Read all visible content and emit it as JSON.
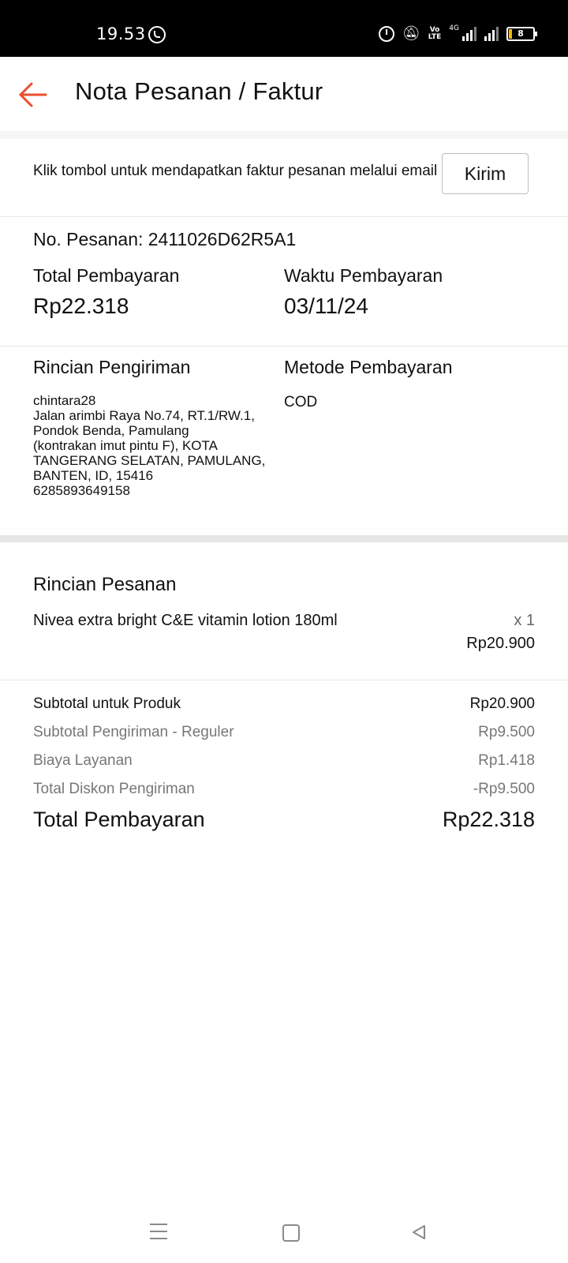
{
  "status_bar": {
    "time": "19.53",
    "network_labels": [
      "VoLTE",
      "4G"
    ],
    "battery": "8"
  },
  "header": {
    "title": "Nota Pesanan / Faktur",
    "accent_color": "#ee4d2d"
  },
  "email_invoice": {
    "message": "Klik tombol untuk mendapatkan faktur pesanan melalui email",
    "button_label": "Kirim"
  },
  "order": {
    "number_label": "No. Pesanan: 2411026D62R5A1",
    "total_label": "Total Pembayaran",
    "total_value": "Rp22.318",
    "payment_time_label": "Waktu Pembayaran",
    "payment_time_value": "03/11/24"
  },
  "shipping": {
    "title": "Rincian Pengiriman",
    "name": "chintara28",
    "address_lines": [
      "Jalan arimbi Raya No.74, RT.1/RW.1,",
      "Pondok Benda, Pamulang",
      "(kontrakan imut pintu F), KOTA",
      "TANGERANG SELATAN, PAMULANG,",
      "BANTEN, ID, 15416"
    ],
    "phone": "6285893649158",
    "payment_method_label": "Metode Pembayaran",
    "payment_method_value": "COD"
  },
  "order_items": {
    "title": "Rincian Pesanan",
    "items": [
      {
        "name": "Nivea extra bright C&E vitamin lotion 180ml",
        "qty": "x 1",
        "price": "Rp20.900"
      }
    ]
  },
  "summary": {
    "rows": [
      {
        "label": "Subtotal untuk Produk",
        "value": "Rp20.900"
      },
      {
        "label": "Subtotal Pengiriman - Reguler",
        "value": "Rp9.500"
      },
      {
        "label": "Biaya Layanan",
        "value": "Rp1.418"
      },
      {
        "label": "Total Diskon Pengiriman",
        "value": "-Rp9.500"
      }
    ],
    "total_label": "Total Pembayaran",
    "total_value": "Rp22.318"
  },
  "nav_bar": {
    "icons": [
      "menu-icon",
      "home-icon",
      "back-triangle-icon"
    ]
  }
}
